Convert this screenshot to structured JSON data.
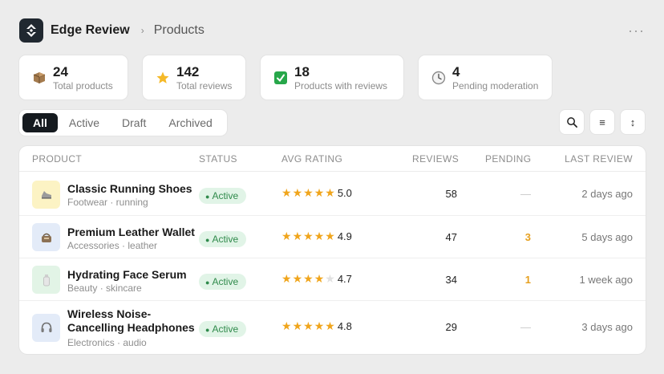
{
  "header": {
    "app_name": "Edge Review",
    "separator": "›",
    "breadcrumb": "Products",
    "more": "···"
  },
  "stats": [
    {
      "value": "24",
      "label": "Total products",
      "icon": "box-icon"
    },
    {
      "value": "142",
      "label": "Total reviews",
      "icon": "star-icon"
    },
    {
      "value": "18",
      "label": "Products with reviews",
      "icon": "check-icon"
    },
    {
      "value": "4",
      "label": "Pending moderation",
      "icon": "clock-icon"
    }
  ],
  "filters": [
    "All",
    "Active",
    "Draft",
    "Archived"
  ],
  "active_filter": "All",
  "tools": {
    "search": "search-icon",
    "filter": "≡",
    "sort": "↕"
  },
  "table": {
    "columns": [
      "PRODUCT",
      "STATUS",
      "AVG RATING",
      "REVIEWS",
      "PENDING",
      "LAST REVIEW"
    ],
    "rows": [
      {
        "name": "Classic Running Shoes",
        "meta": "Footwear · running",
        "thumb_color": "#fcf3c4",
        "thumb_icon": "shoe-icon",
        "status": "Active",
        "rating": "5.0",
        "stars": 5,
        "reviews": "58",
        "pending": "—",
        "last": "2 days ago"
      },
      {
        "name": "Premium Leather Wallet",
        "meta": "Accessories · leather",
        "thumb_color": "#e3ebf8",
        "thumb_icon": "wallet-icon",
        "status": "Active",
        "rating": "4.9",
        "stars": 5,
        "reviews": "47",
        "pending": "3",
        "last": "5 days ago"
      },
      {
        "name": "Hydrating Face Serum",
        "meta": "Beauty · skincare",
        "thumb_color": "#e2f4e6",
        "thumb_icon": "bottle-icon",
        "status": "Active",
        "rating": "4.7",
        "stars": 4,
        "reviews": "34",
        "pending": "1",
        "last": "1 week ago"
      },
      {
        "name": "Wireless Noise-Cancelling Headphones",
        "meta": "Electronics · audio",
        "thumb_color": "#e3ebf8",
        "thumb_icon": "headphones-icon",
        "status": "Active",
        "rating": "4.8",
        "stars": 5,
        "reviews": "29",
        "pending": "—",
        "last": "3 days ago"
      }
    ]
  },
  "colors": {
    "accent": "#f0a51c",
    "status_bg": "#e1f4e7",
    "status_text": "#2f8a4b",
    "dark": "#151a1f"
  }
}
